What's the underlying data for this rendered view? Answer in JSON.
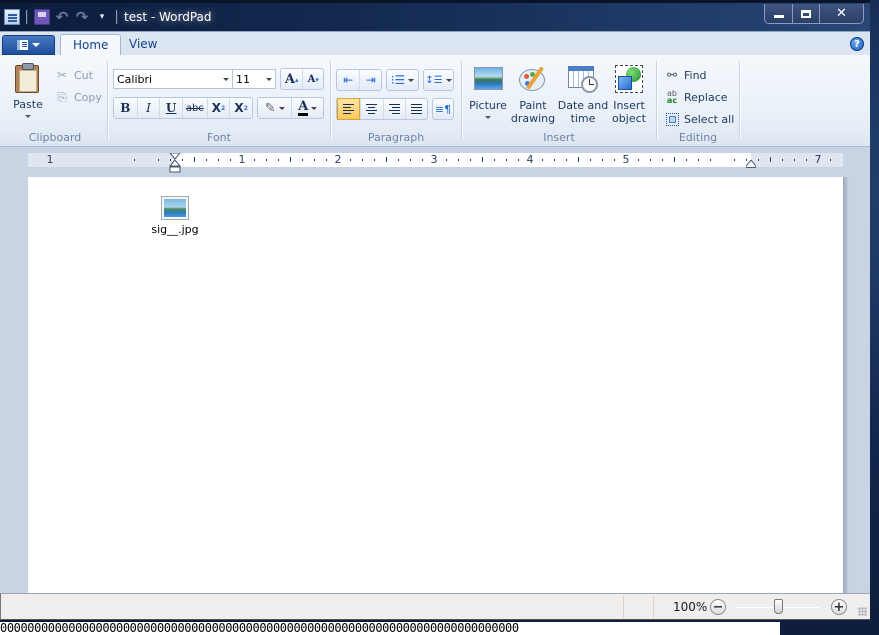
{
  "window": {
    "title": "test - WordPad"
  },
  "quick_access": {
    "items": [
      "app-icon",
      "save-icon",
      "undo-icon",
      "redo-icon",
      "customize-dropdown"
    ]
  },
  "caption_buttons": {
    "minimize": "minimize",
    "maximize": "maximize",
    "close": "close"
  },
  "ribbon": {
    "tabs": [
      {
        "label": "Home",
        "active": true
      },
      {
        "label": "View",
        "active": false
      }
    ],
    "help_glyph": "?",
    "groups": {
      "clipboard": {
        "label": "Clipboard",
        "paste": "Paste",
        "cut": "Cut",
        "copy": "Copy"
      },
      "font": {
        "label": "Font",
        "font_family": "Calibri",
        "font_size": "11",
        "grow": "A",
        "shrink": "A",
        "bold": "B",
        "italic": "I",
        "underline": "U",
        "strikethrough": "abc",
        "subscript": "X",
        "superscript": "X",
        "font_color": "A",
        "font_color_hex": "#000000",
        "highlight_hex": "#ffffff"
      },
      "paragraph": {
        "label": "Paragraph",
        "active_alignment": "left"
      },
      "insert": {
        "label": "Insert",
        "picture": "Picture",
        "paint_drawing_1": "Paint",
        "paint_drawing_2": "drawing",
        "date_time_1": "Date and",
        "date_time_2": "time",
        "insert_object_1": "Insert",
        "insert_object_2": "object"
      },
      "editing": {
        "label": "Editing",
        "find": "Find",
        "replace": "Replace",
        "select_all": "Select all"
      }
    }
  },
  "ruler": {
    "left_labels": [
      "1"
    ],
    "labels": [
      "1",
      "2",
      "3",
      "4",
      "5",
      "7"
    ],
    "unit": "inches"
  },
  "document": {
    "embedded_file": {
      "name": "sig__.jpg",
      "icon": "image-file-icon"
    }
  },
  "statusbar": {
    "zoom_label": "100%",
    "zoom_out": "−",
    "zoom_in": "+",
    "zoom_value_percent": 100
  },
  "desktop": {
    "background_strip_text": "0000000000000000000000000000000000000000000000000000000000000000000000000000"
  },
  "colors": {
    "accent_tab_blue": "#1d4e9c",
    "active_align_yellow": "#fcc85c",
    "ribbon_bg": "#e8eff8"
  }
}
